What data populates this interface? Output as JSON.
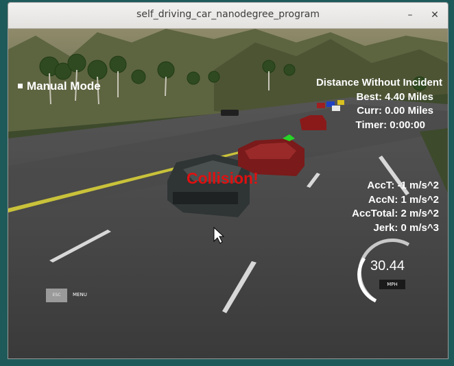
{
  "window": {
    "title": "self_driving_car_nanodegree_program",
    "minimize_glyph": "–",
    "close_glyph": "✕"
  },
  "hud": {
    "mode_label": "Manual Mode",
    "distance_heading": "Distance Without Incident",
    "best": "Best: 4.40 Miles",
    "curr": "Curr: 0.00 Miles",
    "timer": "Timer: 0:00:00",
    "acc_t": "AccT: -1 m/s^2",
    "acc_n": "AccN: 1 m/s^2",
    "acc_total": "AccTotal: 2 m/s^2",
    "jerk": "Jerk: 0 m/s^3",
    "collision": "Collision!",
    "esc_label": "ESC",
    "menu_label": "MENU",
    "speed": "30.44",
    "speed_unit": "MPH",
    "speed_gauge_fraction": 0.3
  },
  "icons": {
    "cursor": "mouse-cursor-icon"
  }
}
